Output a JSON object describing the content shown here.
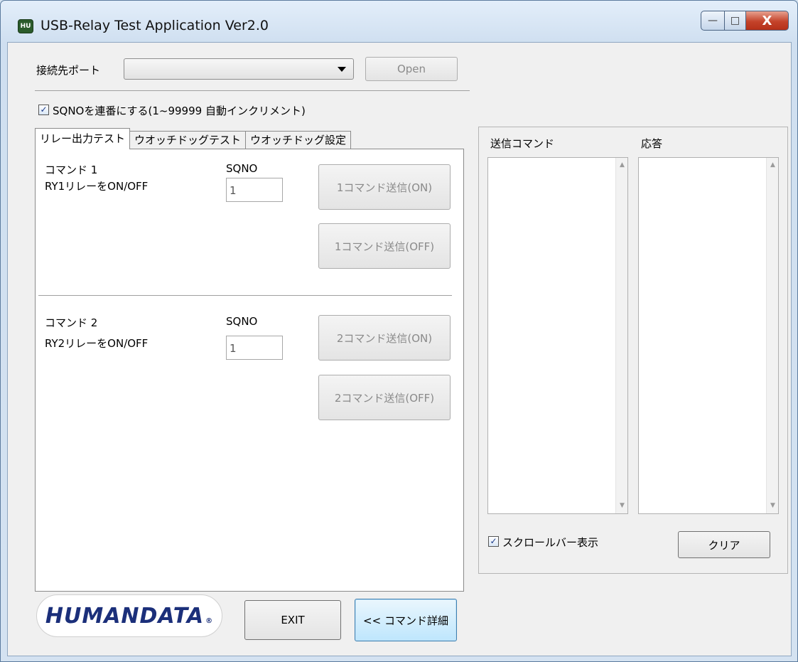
{
  "window": {
    "title": "USB-Relay Test Application Ver2.0",
    "icon_label": "HU",
    "minimize_glyph": "—",
    "maximize_glyph": "□",
    "close_glyph": "X"
  },
  "connection": {
    "port_label": "接続先ポート",
    "port_value": "",
    "open_button": "Open"
  },
  "sqno_checkbox": {
    "label": "SQNOを連番にする(1~99999 自動インクリメント)",
    "checked": true
  },
  "tabs": [
    {
      "label": "リレー出力テスト",
      "active": true
    },
    {
      "label": "ウオッチドッグテスト",
      "active": false
    },
    {
      "label": "ウオッチドッグ設定",
      "active": false
    }
  ],
  "commands": [
    {
      "title": "コマンド 1",
      "description": "RY1リレーをON/OFF",
      "sqno_label": "SQNO",
      "sqno_value": "1",
      "on_button": "1コマンド送信(ON)",
      "off_button": "1コマンド送信(OFF)"
    },
    {
      "title": "コマンド 2",
      "description": "RY2リレーをON/OFF",
      "sqno_label": "SQNO",
      "sqno_value": "1",
      "on_button": "2コマンド送信(ON)",
      "off_button": "2コマンド送信(OFF)"
    }
  ],
  "log": {
    "sent_label": "送信コマンド",
    "response_label": "応答",
    "scroll_up_glyph": "▲",
    "scroll_down_glyph": "▼",
    "scrollbar_checkbox_label": "スクロールバー表示",
    "scrollbar_checked": true,
    "clear_button": "クリア"
  },
  "footer": {
    "logo_text": "HUMANDATA",
    "logo_reg": "®",
    "exit_button": "EXIT",
    "details_button": "<< コマンド詳細"
  },
  "checkmark_glyph": "✓",
  "colors": {
    "title_bar": "#dbe8f6",
    "close_button": "#c4432a",
    "focused_button": "#3c7fb1",
    "logo": "#1b2f7a"
  }
}
